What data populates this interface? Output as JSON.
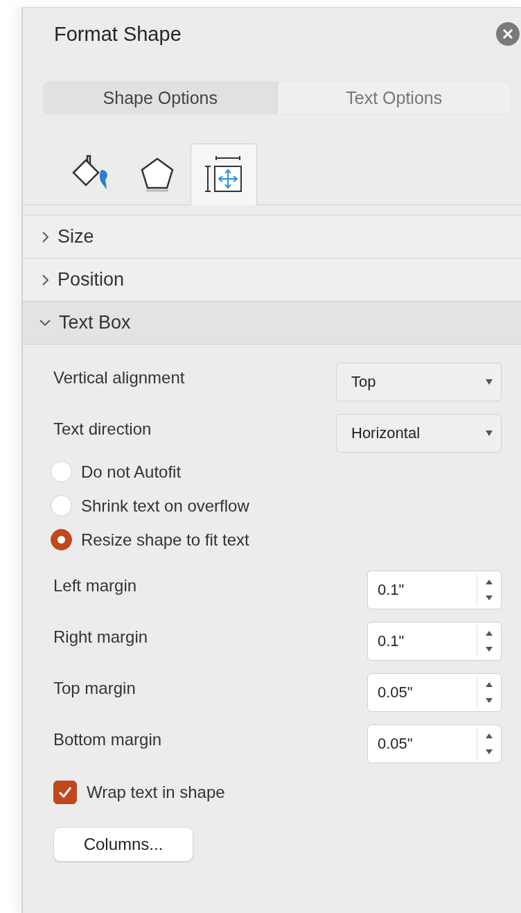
{
  "panel": {
    "title": "Format Shape"
  },
  "option_tabs": [
    {
      "label": "Shape Options",
      "selected": true
    },
    {
      "label": "Text Options",
      "selected": false
    }
  ],
  "icon_tabs": [
    {
      "kind": "fill",
      "selected": false
    },
    {
      "kind": "shape",
      "selected": false
    },
    {
      "kind": "layout",
      "selected": true
    }
  ],
  "sections": [
    {
      "label": "Size",
      "expanded": false
    },
    {
      "label": "Position",
      "expanded": false
    },
    {
      "label": "Text Box",
      "expanded": true
    }
  ],
  "dropdowns": [
    {
      "label": "Vertical alignment",
      "value": "Top"
    },
    {
      "label": "Text direction",
      "value": "Horizontal"
    }
  ],
  "autofit": [
    {
      "label": "Do not Autofit",
      "selected": false
    },
    {
      "label": "Shrink text on overflow",
      "selected": false
    },
    {
      "label": "Resize shape to fit text",
      "selected": true
    }
  ],
  "margins": [
    {
      "label": "Left margin",
      "value": "0.1\""
    },
    {
      "label": "Right margin",
      "value": "0.1\""
    },
    {
      "label": "Top margin",
      "value": "0.05\""
    },
    {
      "label": "Bottom margin",
      "value": "0.05\""
    }
  ],
  "wrap": {
    "label": "Wrap text in shape",
    "checked": true
  },
  "columns_button": "Columns..."
}
